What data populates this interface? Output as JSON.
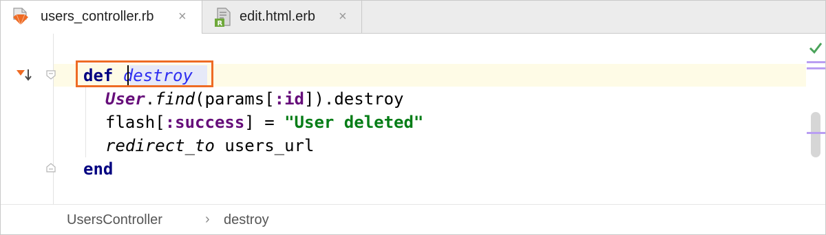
{
  "tabs": [
    {
      "label": "users_controller.rb",
      "active": true,
      "icon": "ruby-controller-icon"
    },
    {
      "label": "edit.html.erb",
      "active": false,
      "icon": "erb-template-icon",
      "icon_badge": "R"
    }
  ],
  "tab_close_glyph": "×",
  "code": {
    "line1": {
      "kw": "def",
      "name": "destroy"
    },
    "line2": {
      "const": "User",
      "dot": ".",
      "call": "find",
      "rest": "(params[",
      "sym": ":id",
      "tail": "]).destroy"
    },
    "line3": {
      "head": "flash[",
      "sym": ":success",
      "mid": "] = ",
      "str": "\"User deleted\""
    },
    "line4": {
      "call": "redirect_to",
      "rest": " users_url"
    },
    "line5": {
      "kw": "end"
    }
  },
  "status": {
    "inspection": "no-problems-check-icon"
  },
  "breadcrumb": {
    "items": [
      "UsersController",
      "destroy"
    ],
    "separator": "›"
  },
  "colors": {
    "focus_outline": "#ee6b24",
    "keyword": "#000080",
    "string": "#067d17",
    "symbol": "#660e7a",
    "current_line": "#fefbe6"
  }
}
